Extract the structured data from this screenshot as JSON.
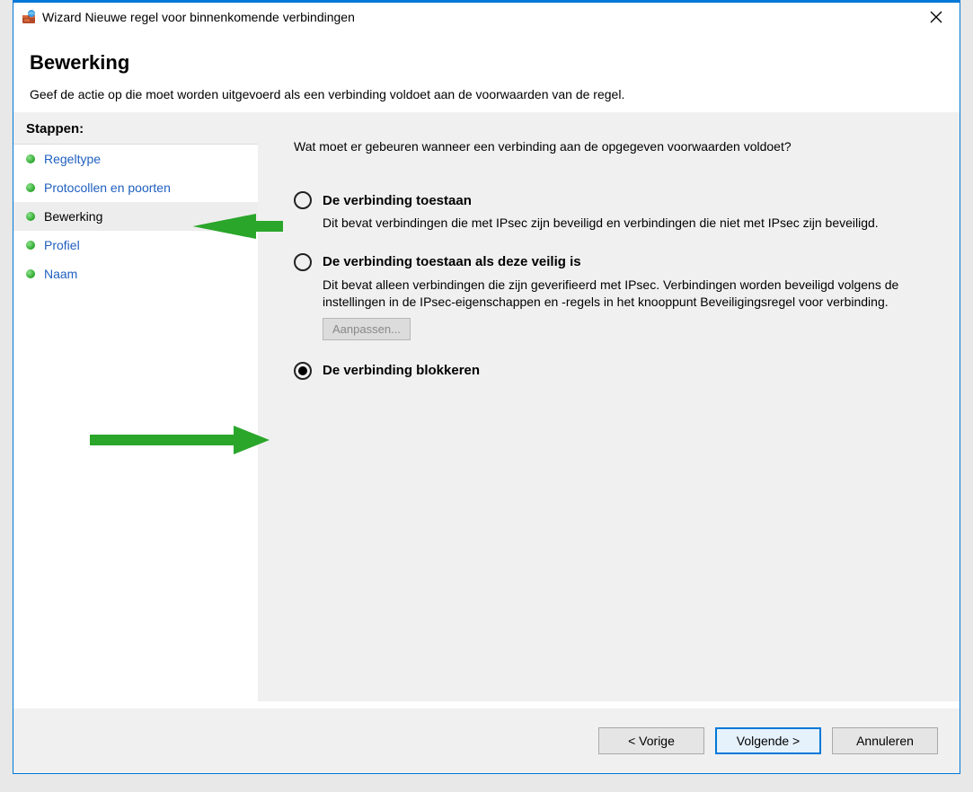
{
  "window": {
    "title": "Wizard Nieuwe regel voor binnenkomende verbindingen"
  },
  "header": {
    "title": "Bewerking",
    "subtitle": "Geef de actie op die moet worden uitgevoerd als een verbinding voldoet aan de voorwaarden van de regel."
  },
  "sidebar": {
    "heading": "Stappen:",
    "items": [
      {
        "label": "Regeltype",
        "current": false
      },
      {
        "label": "Protocollen en poorten",
        "current": false
      },
      {
        "label": "Bewerking",
        "current": true
      },
      {
        "label": "Profiel",
        "current": false
      },
      {
        "label": "Naam",
        "current": false
      }
    ]
  },
  "content": {
    "question": "Wat moet er gebeuren wanneer een verbinding aan de opgegeven voorwaarden voldoet?",
    "options": [
      {
        "label": "De verbinding toestaan",
        "description": "Dit bevat verbindingen die met IPsec zijn beveiligd en verbindingen die niet met IPsec zijn beveiligd.",
        "selected": false
      },
      {
        "label": "De verbinding toestaan als deze veilig is",
        "description": "Dit bevat alleen verbindingen die zijn geverifieerd met IPsec. Verbindingen worden beveiligd volgens de instellingen in de IPsec-eigenschappen en -regels in het knooppunt Beveiligingsregel voor verbinding.",
        "selected": false,
        "customize_label": "Aanpassen..."
      },
      {
        "label": "De verbinding blokkeren",
        "description": "",
        "selected": true
      }
    ]
  },
  "footer": {
    "back": "< Vorige",
    "next": "Volgende >",
    "cancel": "Annuleren"
  }
}
